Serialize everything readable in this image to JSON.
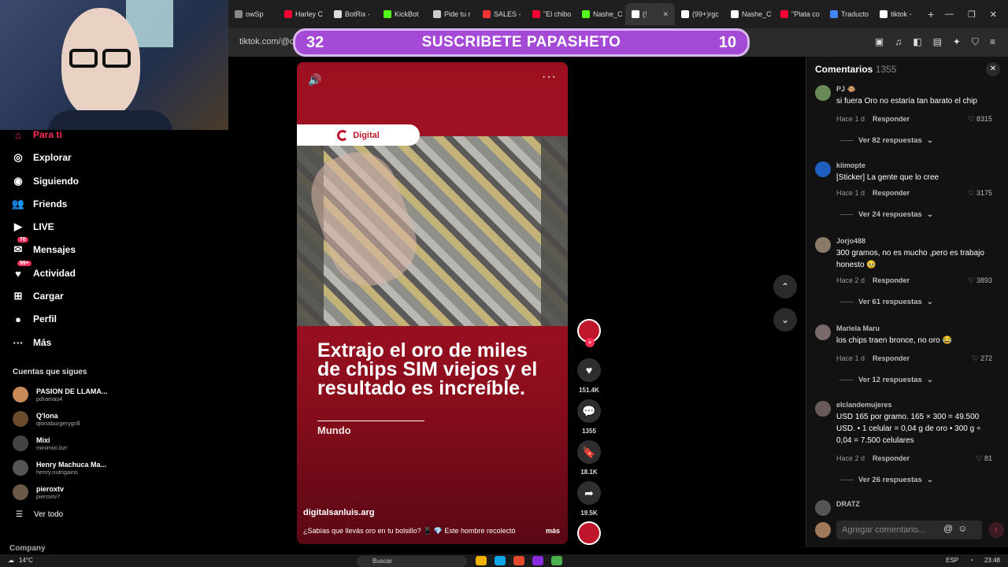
{
  "browser": {
    "tabs": [
      "owSp",
      "Harley C",
      "BotRix -",
      "KickBot",
      "Pide tu r",
      "SALES -",
      "\"El chibo",
      "Nashe_C",
      "(!",
      "(99+)rgc",
      "Nashe_C",
      "\"Plata co",
      "Traducto",
      "tiktok -"
    ],
    "tab_colors": [
      "#888888",
      "#ff0033",
      "#dddddd",
      "#53fc18",
      "#cccccc",
      "#ff3333",
      "#ff0033",
      "#53fc18",
      "#ffffff",
      "#ffffff",
      "#ffffff",
      "#ff0033",
      "#4285f4",
      "#ffffff"
    ],
    "url": "tiktok.com/@di"
  },
  "banner": {
    "left_num": "32",
    "title": "SUSCRIBETE PAPASHETO",
    "right_num": "10"
  },
  "sidebar": {
    "nav": [
      {
        "label": "Para ti",
        "icon": "home-icon"
      },
      {
        "label": "Explorar",
        "icon": "compass-icon"
      },
      {
        "label": "Siguiendo",
        "icon": "following-icon"
      },
      {
        "label": "Friends",
        "icon": "friends-icon"
      },
      {
        "label": "LIVE",
        "icon": "live-icon"
      },
      {
        "label": "Mensajes",
        "icon": "messages-icon",
        "badge": "70"
      },
      {
        "label": "Actividad",
        "icon": "activity-icon",
        "badge": "99+"
      },
      {
        "label": "Cargar",
        "icon": "upload-icon"
      },
      {
        "label": "Perfil",
        "icon": "profile-icon"
      },
      {
        "label": "Más",
        "icon": "more-icon"
      }
    ],
    "following_title": "Cuentas que sigues",
    "following": [
      {
        "name": "PASION DE LLAMA...",
        "user": "pdramas4",
        "color": "#c98a5a"
      },
      {
        "name": "Q'lona",
        "user": "qlonaburgerygrill",
        "color": "#6b4b2b"
      },
      {
        "name": "Mixi",
        "user": "minimixi.bzr",
        "color": "#444444"
      },
      {
        "name": "Henry Machuca Ma...",
        "user": "henry.nutrigains",
        "color": "#555555"
      },
      {
        "name": "pieroxtv",
        "user": "pieroxtv7",
        "color": "#6c5a48"
      }
    ],
    "see_all": "Ver todo",
    "company": "Company"
  },
  "video": {
    "brand": "Digital",
    "headline": "Extrajo el oro de miles de chips SIM viejos y el resultado es increíble.",
    "section": "Mundo",
    "source": "digitalsanluis.arg",
    "caption": "¿Sabías que llevás oro en tu bolsillo? 📱 💎 Este hombre recolectó",
    "more": "más"
  },
  "actions": {
    "likes": "151.4K",
    "comments": "1355",
    "saves": "18.1K",
    "shares": "19.5K"
  },
  "comments": {
    "title": "Comentarios",
    "count": "1355",
    "items": [
      {
        "user": "PJ 🐵",
        "text": "si fuera Oro no estaría tan barato el chip",
        "time": "Hace 1 d",
        "reply": "Responder",
        "likes": "8315",
        "more": "Ver 82 respuestas",
        "color": "#6a8a5a"
      },
      {
        "user": "kiimopte",
        "text": "[Sticker] La gente que lo cree",
        "time": "Hace 1 d",
        "reply": "Responder",
        "likes": "3175",
        "more": "Ver 24 respuestas",
        "color": "#1f5fbf"
      },
      {
        "user": "Jorjo488",
        "text": "300 gramos, no es mucho ,pero es trabajo honesto 🥹",
        "time": "Hace 2 d",
        "reply": "Responder",
        "likes": "3893",
        "more": "Ver 61 respuestas",
        "color": "#8a7a6a"
      },
      {
        "user": "Mariela Maru",
        "text": "los chips traen bronce, no oro 😂",
        "time": "Hace 1 d",
        "reply": "Responder",
        "likes": "272",
        "more": "Ver 12 respuestas",
        "color": "#7a6a6a"
      },
      {
        "user": "elclandemujeres",
        "text": "USD 165 por gramo. 165 × 300 = 49.500 USD. • 1 celular = 0,04 g de oro • 300 g ÷ 0,04 = 7.500 celulares",
        "time": "Hace 2 d",
        "reply": "Responder",
        "likes": "81",
        "more": "Ver 26 respuestas",
        "color": "#6a5a5a"
      },
      {
        "user": "DRATZ",
        "color": "#555555"
      }
    ],
    "input_placeholder": "Agregar comentario..."
  },
  "taskbar": {
    "temp": "14°C",
    "search": "Buscar",
    "lang": "ESP",
    "time": "23:48"
  }
}
